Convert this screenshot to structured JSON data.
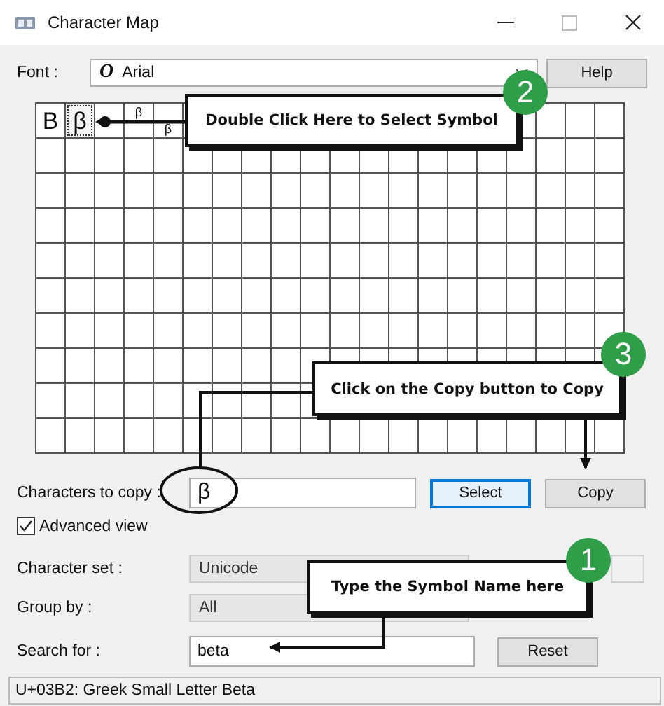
{
  "window": {
    "title": "Character Map"
  },
  "font": {
    "label": "Font :",
    "icon": "O",
    "value": "Arial"
  },
  "help_button": "Help",
  "grid": {
    "cells": [
      {
        "char": "B",
        "kind": "large",
        "selected": false
      },
      {
        "char": "β",
        "kind": "large",
        "selected": true
      },
      {
        "kind": "hidden"
      },
      {
        "char": "β",
        "kind": "small-high",
        "selected": false
      },
      {
        "char": "β",
        "kind": "small-low",
        "selected": false
      }
    ]
  },
  "copy_row": {
    "label": "Characters to copy :",
    "value": "β"
  },
  "buttons": [
    {
      "label": "Select",
      "focused": true
    },
    {
      "label": "Copy",
      "focused": false
    }
  ],
  "advanced_view": {
    "label": "Advanced view",
    "checked": true
  },
  "character_set": {
    "label": "Character set :",
    "value": "Unicode",
    "disabled": true
  },
  "group_by": {
    "label": "Group by :",
    "value": "All",
    "disabled": true
  },
  "search": {
    "label": "Search for :",
    "value": "beta"
  },
  "reset_button": "Reset",
  "status_bar": "U+03B2: Greek Small Letter Beta",
  "callouts": [
    {
      "number": "2",
      "text": "Double Click Here to Select Symbol"
    },
    {
      "number": "3",
      "text": "Click on the Copy button to Copy"
    },
    {
      "number": "1",
      "text": "Type the Symbol Name here"
    }
  ]
}
